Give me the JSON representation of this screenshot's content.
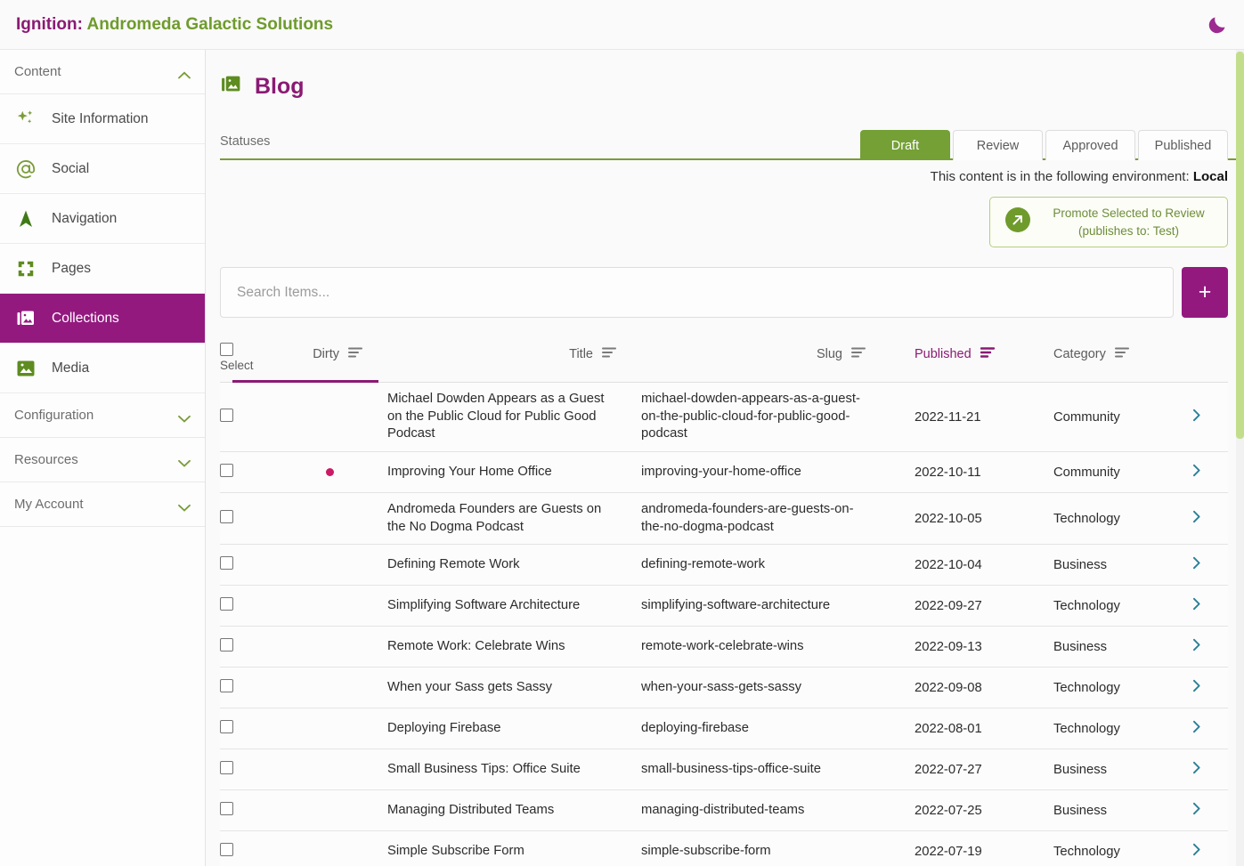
{
  "app": {
    "brand_prefix": "Ignition:",
    "brand_name": "Andromeda Galactic Solutions",
    "dark_mode_icon": "moon-icon"
  },
  "colors": {
    "brand_purple": "#8a1a74",
    "active_nav": "#93197f",
    "brand_green": "#74a036",
    "dirty_dot": "#cc1a66",
    "row_arrow": "#2a7f96",
    "scrollbar": "#c2de8c"
  },
  "sidebar": {
    "sections": [
      {
        "label": "Content",
        "state": "expanded",
        "icon": "chevron-up-icon"
      },
      {
        "label": "Configuration",
        "state": "collapsed",
        "icon": "chevron-down-icon"
      },
      {
        "label": "Resources",
        "state": "collapsed",
        "icon": "chevron-down-icon"
      },
      {
        "label": "My Account",
        "state": "collapsed",
        "icon": "chevron-down-icon"
      }
    ],
    "items": [
      {
        "label": "Site Information",
        "icon": "sparkles-icon",
        "active": false
      },
      {
        "label": "Social",
        "icon": "at-sign-icon",
        "active": false
      },
      {
        "label": "Navigation",
        "icon": "navigation-arrow-icon",
        "active": false
      },
      {
        "label": "Pages",
        "icon": "pages-icon",
        "active": false
      },
      {
        "label": "Collections",
        "icon": "collections-image-icon",
        "active": true
      },
      {
        "label": "Media",
        "icon": "media-image-icon",
        "active": false
      }
    ]
  },
  "page": {
    "title": "Blog",
    "title_icon": "collections-image-icon",
    "statuses_label": "Statuses",
    "environment_text": "This content is in the following environment:",
    "environment_value": "Local",
    "tabs": [
      {
        "label": "Draft",
        "active": true
      },
      {
        "label": "Review",
        "active": false
      },
      {
        "label": "Approved",
        "active": false
      },
      {
        "label": "Published",
        "active": false
      }
    ],
    "promote": {
      "icon": "promote-arrow-icon",
      "line1": "Promote Selected to Review",
      "line2": "(publishes to: Test)"
    }
  },
  "search": {
    "placeholder": "Search Items...",
    "value": "",
    "add_button_label": "+",
    "add_button_icon": "plus-icon"
  },
  "table": {
    "select_label": "Select",
    "columns": [
      {
        "key": "dirty",
        "label": "Dirty",
        "sort_icon": "sort-icon",
        "sorted": false
      },
      {
        "key": "title",
        "label": "Title",
        "sort_icon": "sort-icon",
        "sorted": false
      },
      {
        "key": "slug",
        "label": "Slug",
        "sort_icon": "sort-icon",
        "sorted": false
      },
      {
        "key": "published",
        "label": "Published",
        "sort_icon": "sort-desc-icon",
        "sorted": true
      },
      {
        "key": "category",
        "label": "Category",
        "sort_icon": "sort-icon",
        "sorted": false
      }
    ],
    "rows": [
      {
        "dirty": false,
        "title": "Michael Dowden Appears as a Guest on the Public Cloud for Public Good Podcast",
        "slug": "michael-dowden-appears-as-a-guest-on-the-public-cloud-for-public-good-podcast",
        "published": "2022-11-21",
        "category": "Community"
      },
      {
        "dirty": true,
        "title": "Improving Your Home Office",
        "slug": "improving-your-home-office",
        "published": "2022-10-11",
        "category": "Community"
      },
      {
        "dirty": false,
        "title": "Andromeda Founders are Guests on the No Dogma Podcast",
        "slug": "andromeda-founders-are-guests-on-the-no-dogma-podcast",
        "published": "2022-10-05",
        "category": "Technology"
      },
      {
        "dirty": false,
        "title": "Defining Remote Work",
        "slug": "defining-remote-work",
        "published": "2022-10-04",
        "category": "Business"
      },
      {
        "dirty": false,
        "title": "Simplifying Software Architecture",
        "slug": "simplifying-software-architecture",
        "published": "2022-09-27",
        "category": "Technology"
      },
      {
        "dirty": false,
        "title": "Remote Work: Celebrate Wins",
        "slug": "remote-work-celebrate-wins",
        "published": "2022-09-13",
        "category": "Business"
      },
      {
        "dirty": false,
        "title": "When your Sass gets Sassy",
        "slug": "when-your-sass-gets-sassy",
        "published": "2022-09-08",
        "category": "Technology"
      },
      {
        "dirty": false,
        "title": "Deploying Firebase",
        "slug": "deploying-firebase",
        "published": "2022-08-01",
        "category": "Technology"
      },
      {
        "dirty": false,
        "title": "Small Business Tips: Office Suite",
        "slug": "small-business-tips-office-suite",
        "published": "2022-07-27",
        "category": "Business"
      },
      {
        "dirty": false,
        "title": "Managing Distributed Teams",
        "slug": "managing-distributed-teams",
        "published": "2022-07-25",
        "category": "Business"
      },
      {
        "dirty": false,
        "title": "Simple Subscribe Form",
        "slug": "simple-subscribe-form",
        "published": "2022-07-19",
        "category": "Technology"
      }
    ]
  }
}
